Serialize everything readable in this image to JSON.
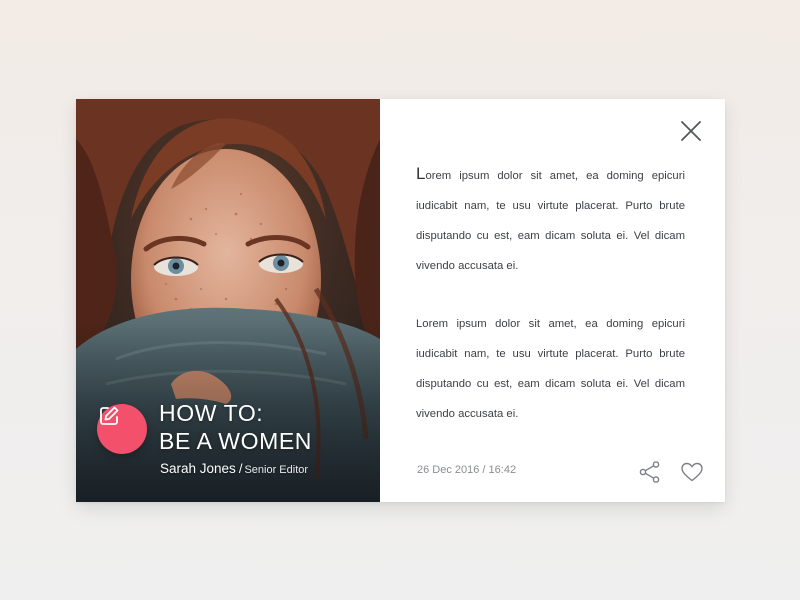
{
  "article": {
    "headline_line1": "HOW TO:",
    "headline_line2": "BE A WOMEN",
    "author_name": "Sarah Jones",
    "author_separator": "/",
    "author_role": "Senior Editor",
    "date": "26 Dec 2016 / 16:42",
    "paragraphs": [
      {
        "initial": "L",
        "text": "orem ipsum dolor sit amet, ea doming epicuri iudicabit nam, te usu virtute placerat. Purto brute disputando cu est, eam dicam soluta ei. Vel dicam vivendo accusata ei."
      },
      {
        "text": "Lorem ipsum dolor sit amet, ea doming epicuri iudicabit nam, te usu virtute placerat. Purto brute disputando cu est, eam dicam soluta ei. Vel dicam vivendo accusata ei."
      }
    ]
  },
  "icons": {
    "edit": "pencil-square-icon",
    "close": "close-icon",
    "share": "share-icon",
    "like": "heart-icon"
  },
  "colors": {
    "accent": "#f2506b",
    "text": "#3e4048",
    "muted": "#8b8d93",
    "card": "#ffffff"
  }
}
